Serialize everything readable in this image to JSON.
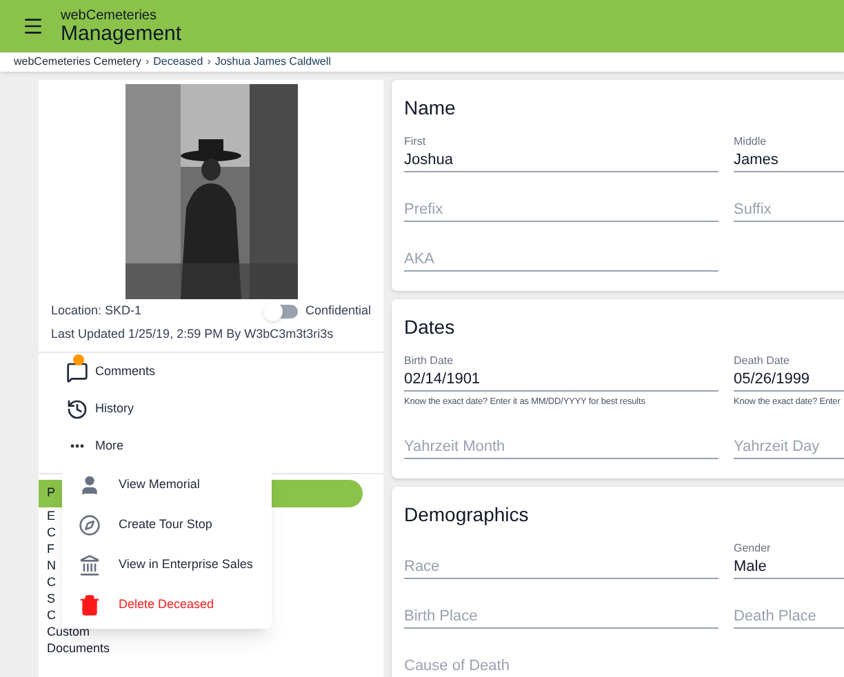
{
  "app_bar": {
    "subtitle": "webCemeteries",
    "title": "Management"
  },
  "breadcrumb": [
    {
      "label": "webCemeteries Cemetery",
      "link": false,
      "separator": "›"
    },
    {
      "label": "Deceased",
      "link": true,
      "separator": "›"
    },
    {
      "label": "Joshua James Caldwell",
      "link": true
    }
  ],
  "profile": {
    "location": "Location: SKD-1",
    "confidential": {
      "label": "Confidential",
      "on": false
    },
    "last_updated": "Last Updated 1/25/19, 2:59 PM By W3bC3m3t3ri3s"
  },
  "actions": [
    {
      "kind": "comments",
      "label": "Comments",
      "badge": true
    },
    {
      "kind": "history",
      "label": "History",
      "badge": false
    },
    {
      "kind": "more",
      "label": "More",
      "badge": false
    }
  ],
  "sections": [
    {
      "label": "P",
      "selected": true
    },
    {
      "label": "E",
      "selected": false
    },
    {
      "label": "C",
      "selected": false
    },
    {
      "label": "F",
      "selected": false
    },
    {
      "label": "N",
      "selected": false
    },
    {
      "label": "C",
      "selected": false
    },
    {
      "label": "S",
      "selected": false
    },
    {
      "label": "C",
      "selected": false
    },
    {
      "label": "Custom",
      "selected": false
    },
    {
      "label": "Documents",
      "selected": false
    }
  ],
  "menu": [
    {
      "kind": "person",
      "label": "View Memorial",
      "danger": false
    },
    {
      "kind": "compass",
      "label": "Create Tour Stop",
      "danger": false
    },
    {
      "kind": "bank",
      "label": "View in Enterprise Sales",
      "danger": false
    },
    {
      "kind": "trash",
      "label": "Delete Deceased",
      "danger": true
    }
  ],
  "cards": [
    {
      "title": "Name",
      "rows": [
        [
          {
            "label": "First",
            "value": "Joshua"
          },
          {
            "label": "Middle",
            "value": "James"
          }
        ],
        [
          {
            "placeholder": "Prefix"
          },
          {
            "placeholder": "Suffix"
          }
        ],
        [
          {
            "placeholder": "AKA"
          }
        ]
      ]
    },
    {
      "title": "Dates",
      "rows": [
        [
          {
            "label": "Birth Date",
            "value": "02/14/1901",
            "helper": "Know the exact date? Enter it as MM/DD/YYYY for best results"
          },
          {
            "label": "Death Date",
            "value": "05/26/1999",
            "helper": "Know the exact date? Enter"
          }
        ],
        [
          {
            "placeholder": "Yahrzeit Month"
          },
          {
            "placeholder": "Yahrzeit Day"
          }
        ]
      ]
    },
    {
      "title": "Demographics",
      "rows": [
        [
          {
            "placeholder": "Race"
          },
          {
            "label": "Gender",
            "value": "Male"
          }
        ],
        [
          {
            "placeholder": "Birth Place"
          },
          {
            "placeholder": "Death Place"
          }
        ],
        [
          {
            "placeholder": "Cause of Death"
          }
        ]
      ]
    }
  ]
}
